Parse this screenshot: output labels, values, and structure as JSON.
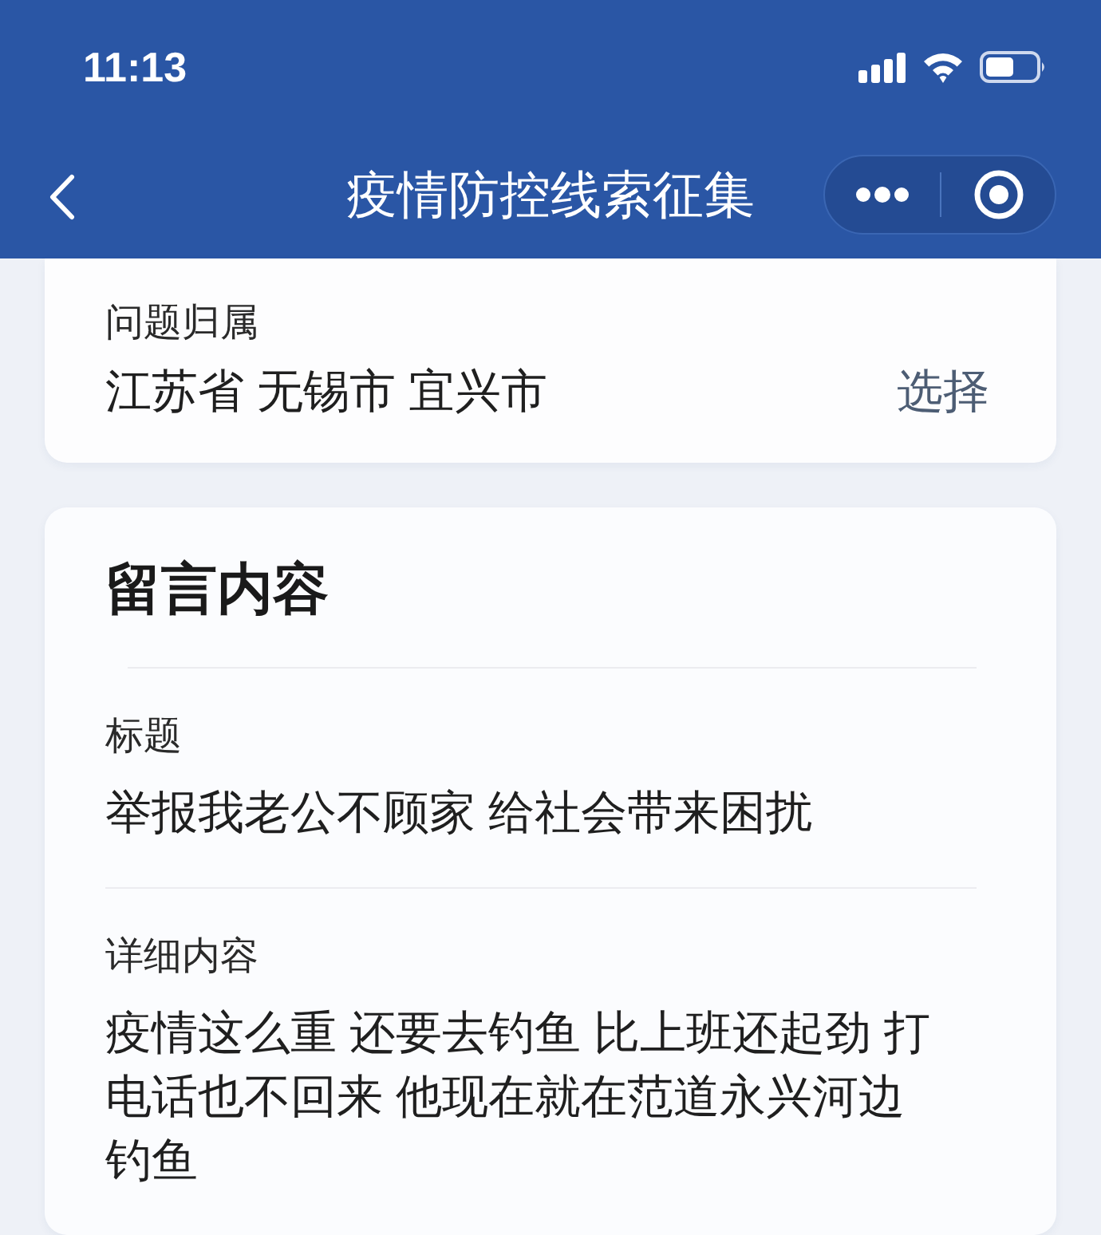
{
  "status_bar": {
    "time": "11:13"
  },
  "nav_bar": {
    "title": "疫情防控线索征集"
  },
  "location_card": {
    "label": "问题归属",
    "value": "江苏省 无锡市 宜兴市",
    "action": "选择"
  },
  "message_card": {
    "heading": "留言内容",
    "fields": [
      {
        "label": "标题",
        "value": "举报我老公不顾家 给社会带来困扰"
      },
      {
        "label": "详细内容",
        "value": "疫情这么重 还要去钓鱼 比上班还起劲 打电话也不回来 他现在就在范道永兴河边钓鱼"
      }
    ]
  }
}
